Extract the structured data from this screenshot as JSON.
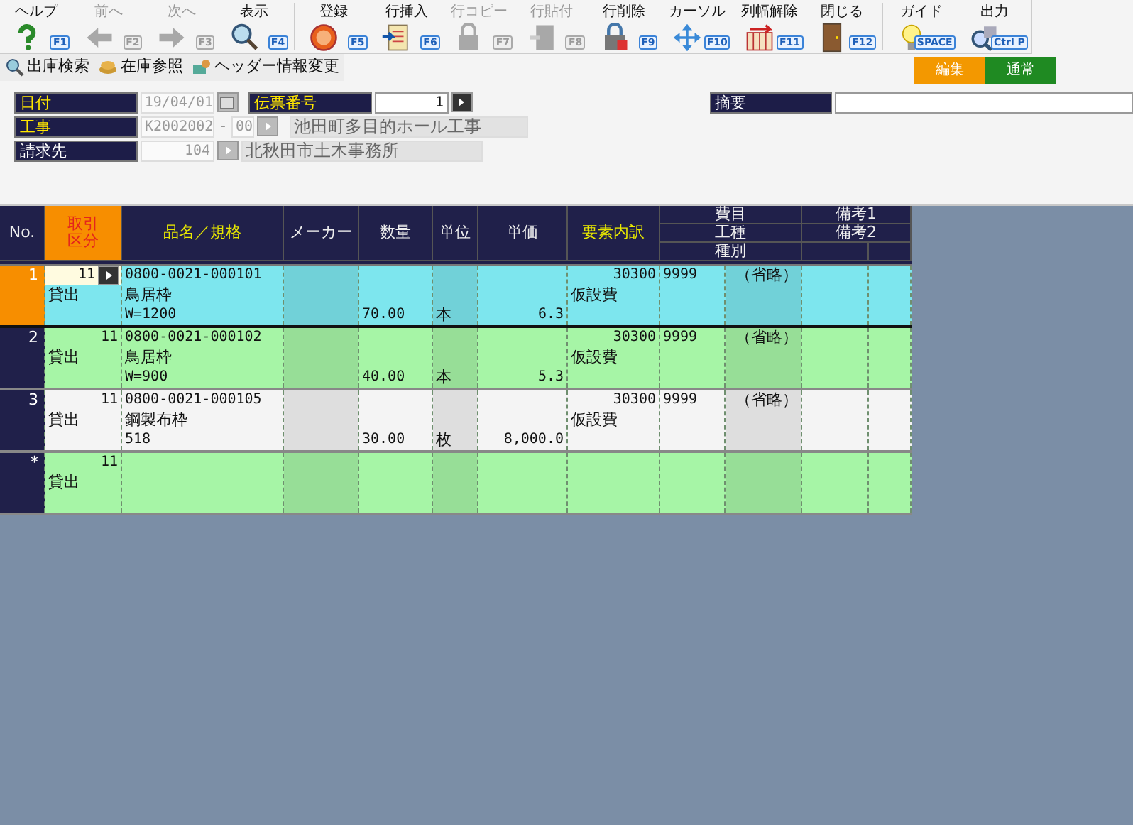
{
  "toolbar": [
    {
      "label": "ヘルプ",
      "key": "F1",
      "disabled": false
    },
    {
      "label": "前へ",
      "key": "F2",
      "disabled": true
    },
    {
      "label": "次へ",
      "key": "F3",
      "disabled": true
    },
    {
      "label": "表示",
      "key": "F4",
      "disabled": false,
      "group_end": true
    },
    {
      "label": "登録",
      "key": "F5",
      "disabled": false
    },
    {
      "label": "行挿入",
      "key": "F6",
      "disabled": false
    },
    {
      "label": "行コピー",
      "key": "F7",
      "disabled": true
    },
    {
      "label": "行貼付",
      "key": "F8",
      "disabled": true
    },
    {
      "label": "行削除",
      "key": "F9",
      "disabled": false
    },
    {
      "label": "カーソル",
      "key": "F10",
      "disabled": false
    },
    {
      "label": "列幅解除",
      "key": "F11",
      "disabled": false
    },
    {
      "label": "閉じる",
      "key": "F12",
      "disabled": false,
      "group_end": true
    },
    {
      "label": "ガイド",
      "key": "SPACE",
      "disabled": false
    },
    {
      "label": "出力",
      "key": "Ctrl P",
      "disabled": false
    }
  ],
  "links": [
    "出庫検索",
    "在庫参照",
    "ヘッダー情報変更"
  ],
  "modes": [
    {
      "label": "編集",
      "color": "#f39800"
    },
    {
      "label": "通常",
      "color": "#1f8a22"
    }
  ],
  "header": {
    "date": {
      "label": "日付",
      "required": true,
      "value": "19/04/01"
    },
    "slip": {
      "label": "伝票番号",
      "required": true,
      "value": "1"
    },
    "summary": {
      "label": "摘要",
      "required": false
    },
    "project": {
      "label": "工事",
      "required": true,
      "code": "K2002002",
      "sep": "-",
      "branch": "00",
      "name": "池田町多目的ホール工事"
    },
    "billing": {
      "label": "請求先",
      "required": false,
      "code": "104",
      "name": "北秋田市土木事務所"
    }
  },
  "table": {
    "columns": [
      {
        "label": "No.",
        "kind": "plain"
      },
      {
        "label": "取引区分",
        "kind": "active"
      },
      {
        "label": "品名／規格",
        "kind": "accent"
      },
      {
        "label": "メーカー",
        "kind": "plain"
      },
      {
        "label": "数量",
        "kind": "plain"
      },
      {
        "label": "単位",
        "kind": "plain"
      },
      {
        "label": "単価",
        "kind": "plain"
      },
      {
        "label": "要素内訳",
        "kind": "accent"
      }
    ],
    "stack_1": [
      "費目",
      "工種",
      "種別"
    ],
    "stack_2": [
      "備考1",
      "備考2"
    ],
    "rows": [
      {
        "no": "1",
        "selected": true,
        "color": "#7de6ee",
        "tcode": "11",
        "type": "貸出",
        "code": "0800-0021-000101",
        "name": "鳥居枠",
        "spec": "W=1200",
        "qty": "70.00",
        "unit": "本",
        "price": "6.3",
        "el_code": "30300",
        "el_name": "仮設費",
        "himoku": "9999",
        "shubetsu": "（省略）"
      },
      {
        "no": "2",
        "selected": false,
        "color": "#a6f5a6",
        "tcode": "11",
        "type": "貸出",
        "code": "0800-0021-000102",
        "name": "鳥居枠",
        "spec": "W=900",
        "qty": "40.00",
        "unit": "本",
        "price": "5.3",
        "el_code": "30300",
        "el_name": "仮設費",
        "himoku": "9999",
        "shubetsu": "（省略）"
      },
      {
        "no": "3",
        "selected": false,
        "color": "#f4f4f4",
        "tcode": "11",
        "type": "貸出",
        "code": "0800-0021-000105",
        "name": "鋼製布枠",
        "spec": "518",
        "qty": "30.00",
        "unit": "枚",
        "price": "8,000.0",
        "el_code": "30300",
        "el_name": "仮設費",
        "himoku": "9999",
        "shubetsu": "（省略）"
      },
      {
        "no": "*",
        "selected": false,
        "color": "#a6f5a6",
        "tcode": "11",
        "type": "貸出"
      }
    ]
  }
}
